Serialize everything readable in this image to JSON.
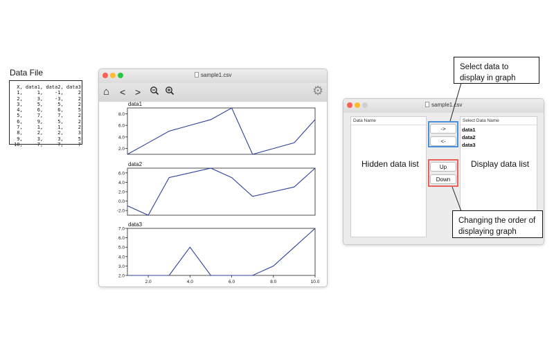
{
  "data_file": {
    "title": "Data File",
    "content": " X, data1, data2, data3\n 1,     1,    -1,     2\n 2,     3,    -3,     2\n 3,     5,     5,     2\n 4,     6,     6,     5\n 5,     7,     7,     2\n 6,     9,     5,     2\n 7,     1,     1,     2\n 8,     2,     2,     3\n 9,     3,     3,     5\n10,     7,     7,     7"
  },
  "plot_window": {
    "title": "sample1.csv",
    "toolbar": {
      "home": "⌂",
      "back": "<",
      "forward": ">",
      "zoom_out": "🔍−",
      "zoom_in": "🔍+",
      "settings": "⚙"
    }
  },
  "selector_window": {
    "title": "sample1.csv",
    "hidden_header": "Data Name",
    "hidden_label": "Hidden data list",
    "display_header": "Select Data Name",
    "display_label": "Display data list",
    "display_items": [
      "data1",
      "data2",
      "data3"
    ],
    "btn_right": "->",
    "btn_left": "<-",
    "btn_up": "Up",
    "btn_down": "Down"
  },
  "callouts": {
    "select": "Select data to display in graph",
    "order": "Changing the order of displaying graph"
  },
  "colors": {
    "line": "#2d3fa0",
    "blue_highlight": "#4a90d9",
    "red_highlight": "#e8605a"
  },
  "chart_data": [
    {
      "type": "line",
      "title": "data1",
      "x": [
        1,
        2,
        3,
        4,
        5,
        6,
        7,
        8,
        9,
        10
      ],
      "series": [
        {
          "values": [
            1,
            3,
            5,
            6,
            7,
            9,
            1,
            2,
            3,
            7
          ]
        }
      ],
      "ylim": [
        1,
        9
      ],
      "yticks": [
        "2.0",
        "4.0",
        "6.0",
        "8.0"
      ],
      "xlim": [
        1,
        10
      ],
      "xticks": []
    },
    {
      "type": "line",
      "title": "data2",
      "x": [
        1,
        2,
        3,
        4,
        5,
        6,
        7,
        8,
        9,
        10
      ],
      "series": [
        {
          "values": [
            -1,
            -3,
            5,
            6,
            7,
            5,
            1,
            2,
            3,
            7
          ]
        }
      ],
      "ylim": [
        -3,
        7
      ],
      "yticks": [
        "-2.0",
        "0.0",
        "2.0",
        "4.0",
        "6.0"
      ],
      "xlim": [
        1,
        10
      ],
      "xticks": []
    },
    {
      "type": "line",
      "title": "data3",
      "x": [
        1,
        2,
        3,
        4,
        5,
        6,
        7,
        8,
        9,
        10
      ],
      "series": [
        {
          "values": [
            2,
            2,
            2,
            5,
            2,
            2,
            2,
            3,
            5,
            7
          ]
        }
      ],
      "ylim": [
        2,
        7
      ],
      "yticks": [
        "2.0",
        "3.0",
        "4.0",
        "5.0",
        "6.0",
        "7.0"
      ],
      "xlim": [
        1,
        10
      ],
      "xticks": [
        "2.0",
        "4.0",
        "6.0",
        "8.0",
        "10.0"
      ]
    }
  ]
}
